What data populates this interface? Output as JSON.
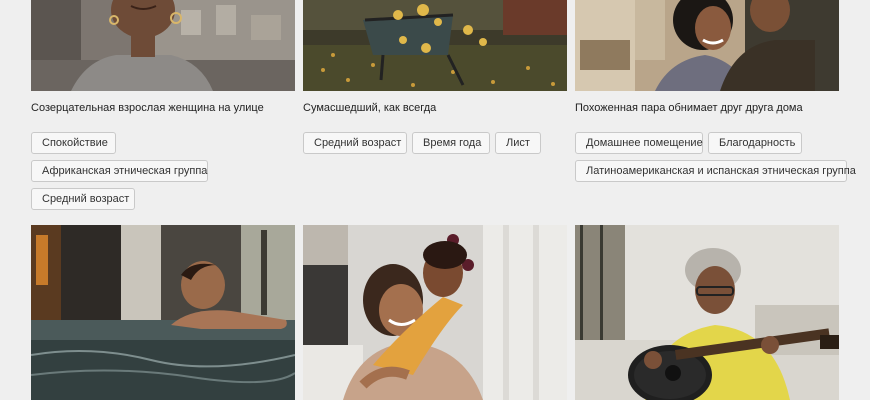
{
  "cards": [
    {
      "caption": "Созерцательная взрослая женщина на улице",
      "tags": [
        "Спокойствие",
        "Африканская этническая группа",
        "Средний возраст"
      ]
    },
    {
      "caption": "Сумасшедший, как всегда",
      "tags": [
        "Средний возраст",
        "Время года",
        "Лист"
      ]
    },
    {
      "caption": "Похоженная пара обнимает друг друга дома",
      "tags": [
        "Домашнее помещение",
        "Благодарность",
        "Латиноамериканская и испанская этническая группа"
      ]
    }
  ]
}
